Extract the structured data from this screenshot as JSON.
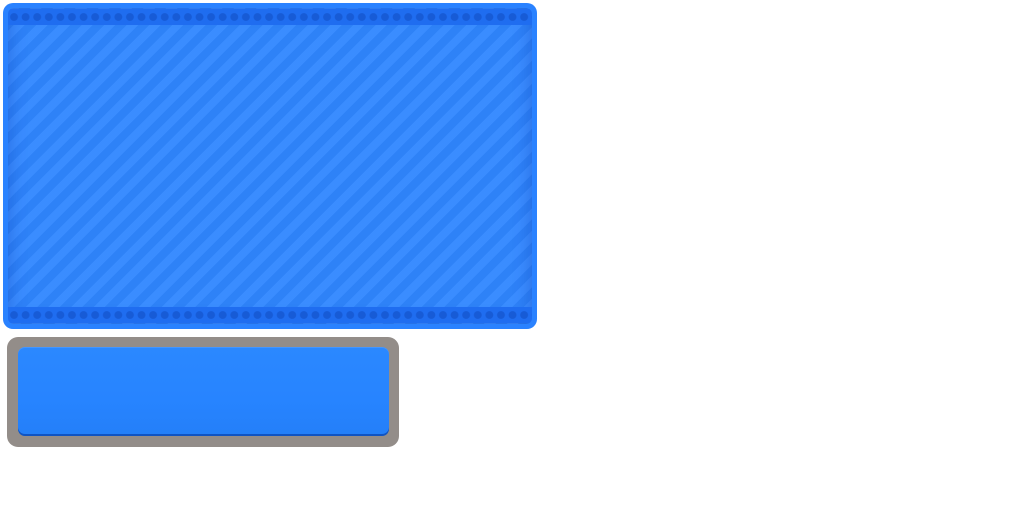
{
  "colors": {
    "panel_border": "#2a82ff",
    "panel_fill": "#2f86ff",
    "rivet_strip": "#1f6df0",
    "rivet": "#175bd6",
    "button_frame": "#938d89",
    "button_face": "#2784ff",
    "background": "#ffffff"
  },
  "icons": {
    "panel_rivets": "rivet-row-icon"
  }
}
